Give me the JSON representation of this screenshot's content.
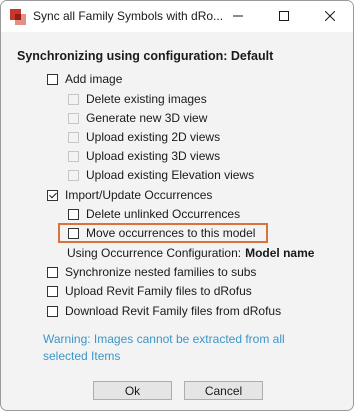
{
  "window": {
    "title": "Sync all Family Symbols with dRo...",
    "controls": [
      "minimize-icon",
      "maximize-icon",
      "close-icon"
    ]
  },
  "heading": "Synchronizing using configuration:  Default",
  "options": {
    "add_image": {
      "label": "Add image",
      "checked": false,
      "enabled": true
    },
    "delete_existing_images": {
      "label": "Delete existing images",
      "checked": false,
      "enabled": false
    },
    "generate_new_3d_view": {
      "label": "Generate new 3D view",
      "checked": false,
      "enabled": false
    },
    "upload_existing_2d_views": {
      "label": "Upload existing 2D views",
      "checked": false,
      "enabled": false
    },
    "upload_existing_3d_views": {
      "label": "Upload existing 3D views",
      "checked": false,
      "enabled": false
    },
    "upload_existing_elevation_views": {
      "label": "Upload existing Elevation views",
      "checked": false,
      "enabled": false
    },
    "import_update_occurrences": {
      "label": "Import/Update Occurrences",
      "checked": true,
      "enabled": true
    },
    "delete_unlinked_occurrences": {
      "label": "Delete unlinked Occurrences",
      "checked": false,
      "enabled": true
    },
    "move_occurrences": {
      "label": "Move occurrences to this model",
      "checked": false,
      "enabled": true
    },
    "synchronize_nested": {
      "label": "Synchronize nested families to subs",
      "checked": false,
      "enabled": true
    },
    "upload_revit_family": {
      "label": "Upload Revit Family files to dRofus",
      "checked": false,
      "enabled": true
    },
    "download_revit_family": {
      "label": "Download Revit Family files from dRofus",
      "checked": false,
      "enabled": true
    }
  },
  "occurrence_configuration": {
    "label": "Using Occurrence Configuration:",
    "value": "Model name"
  },
  "warning": "Warning: Images cannot be extracted from all selected Items",
  "buttons": {
    "ok": "Ok",
    "cancel": "Cancel"
  },
  "colors": {
    "warning_text": "#3c96c8",
    "highlight_border": "#d9733a",
    "app_icon_red": "#c8352b"
  }
}
